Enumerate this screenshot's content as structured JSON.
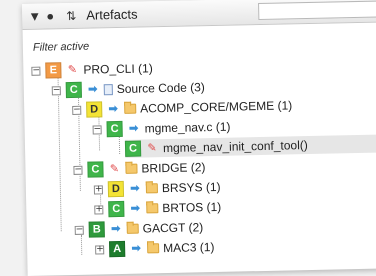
{
  "toolbar": {
    "title": "Artefacts",
    "search_value": "",
    "icons": [
      "filter-icon",
      "tag-icon",
      "sort-icon"
    ]
  },
  "filter_status": "Filter active",
  "tree": [
    {
      "label": "PRO_CLI (1)",
      "badge": "E",
      "relation": "pencil",
      "toggle": "-"
    },
    {
      "label": "Source Code (3)",
      "badge": "C",
      "relation": "arrow",
      "item_icon": "document",
      "toggle": "-"
    },
    {
      "label": "ACOMP_CORE/MGEME (1)",
      "badge": "D",
      "relation": "arrow",
      "item_icon": "folder",
      "toggle": "-"
    },
    {
      "label": "mgme_nav.c (1)",
      "badge": "C",
      "relation": "arrow",
      "toggle": "-"
    },
    {
      "label": "mgme_nav_init_conf_tool()",
      "badge": "C",
      "relation": "pencil",
      "selected": true
    },
    {
      "label": "BRIDGE (2)",
      "badge": "C",
      "relation": "pencil",
      "item_icon": "folder",
      "toggle": "-"
    },
    {
      "label": "BRSYS (1)",
      "badge": "D",
      "relation": "arrow",
      "item_icon": "folder",
      "toggle": "+"
    },
    {
      "label": "BRTOS (1)",
      "badge": "C",
      "relation": "arrow",
      "item_icon": "folder",
      "toggle": "+"
    },
    {
      "label": "GACGT (2)",
      "badge": "B",
      "relation": "arrow",
      "item_icon": "folder",
      "toggle": "-"
    },
    {
      "label": "MAC3 (1)",
      "badge": "A",
      "relation": "arrow",
      "item_icon": "folder",
      "toggle": "+"
    }
  ]
}
